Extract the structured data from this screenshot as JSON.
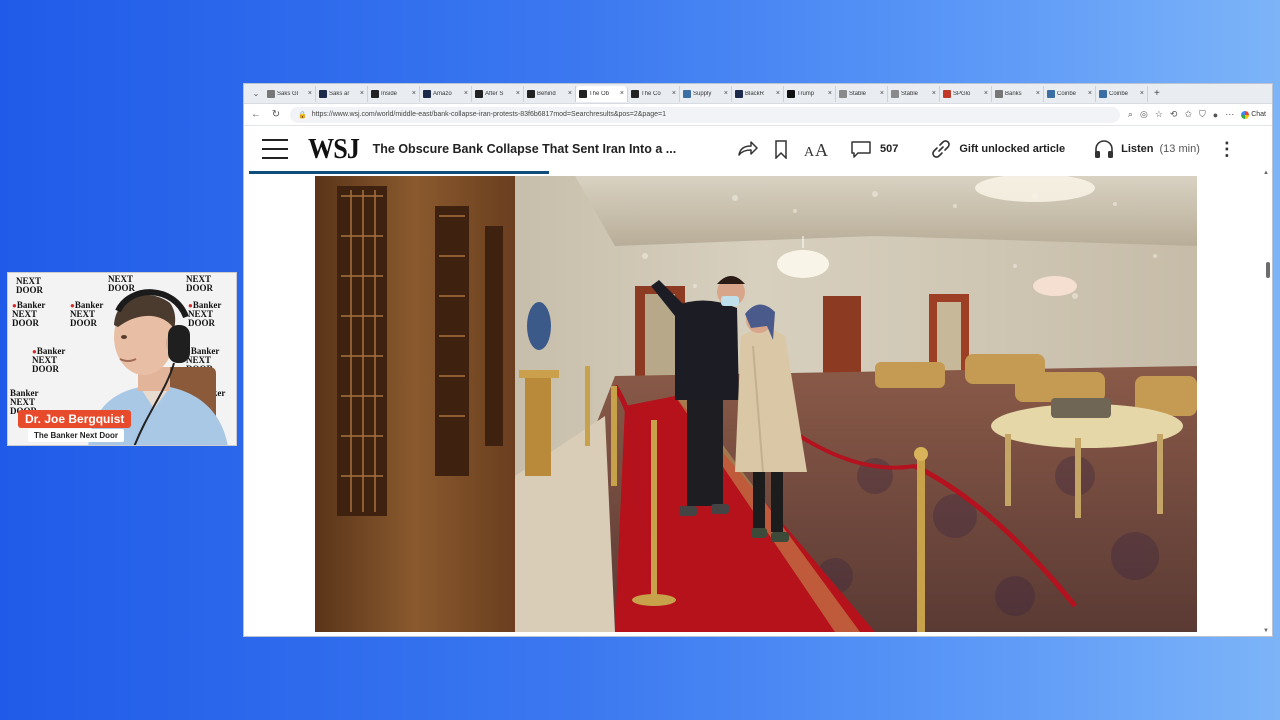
{
  "webcam": {
    "backdrop_logo_line1": "Banker",
    "backdrop_logo_line2": "NEXT DOOR",
    "presenter_name": "Dr. Joe Bergquist",
    "show_name": "The Banker Next Door"
  },
  "browser": {
    "tabs": [
      {
        "label": "Saks Gl",
        "color": "#777777"
      },
      {
        "label": "Saks ar",
        "color": "#1b2a4a"
      },
      {
        "label": "Inside",
        "color": "#222222"
      },
      {
        "label": "Amazo",
        "color": "#1b2a4a"
      },
      {
        "label": "After S",
        "color": "#222222"
      },
      {
        "label": "Behind",
        "color": "#222222"
      },
      {
        "label": "The Ob",
        "color": "#222222"
      },
      {
        "label": "The Co",
        "color": "#222222"
      },
      {
        "label": "Supply",
        "color": "#3a6ea5"
      },
      {
        "label": "BlackR",
        "color": "#1b2a4a"
      },
      {
        "label": "Trump",
        "color": "#111111"
      },
      {
        "label": "Stable",
        "color": "#8a8a8a"
      },
      {
        "label": "Stable",
        "color": "#8a8a8a"
      },
      {
        "label": "SPGlo",
        "color": "#c0392b"
      },
      {
        "label": "Banks",
        "color": "#777777"
      },
      {
        "label": "Coinbe",
        "color": "#3a6ea5"
      },
      {
        "label": "Coinbe",
        "color": "#3a6ea5"
      }
    ],
    "url": "https://www.wsj.com/world/middle-east/bank-collapse-iran-protests-83f6b6817mod=Searchresults&pos=2&page=1",
    "chat_label": "Chat"
  },
  "article": {
    "logo": "WSJ",
    "headline": "The Obscure Bank Collapse That Sent Iran Into a ...",
    "comment_count": "507",
    "gift_label": "Gift unlocked article",
    "listen_label": "Listen",
    "listen_duration": "(13 min)",
    "read_progress": 0.3
  }
}
